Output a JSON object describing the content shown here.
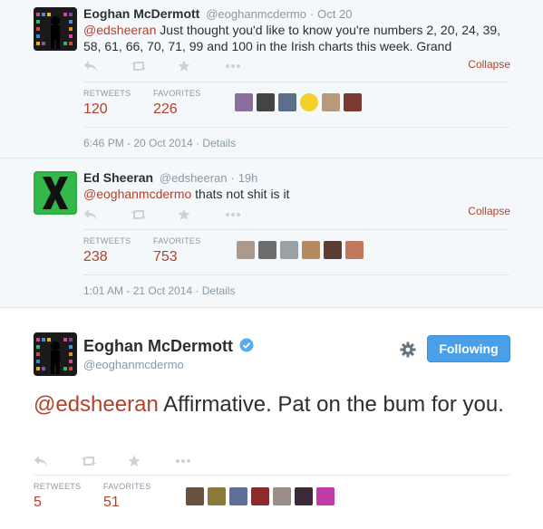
{
  "tweets": [
    {
      "name": "Eoghan McDermott",
      "handle": "@eoghanmcdermo",
      "date": "Oct 20",
      "mention": "@edsheeran",
      "text": " Just thought you'd like to know you're numbers 2, 20, 24, 39, 58, 61, 66, 70, 71, 99 and 100 in the Irish charts this week. Grand",
      "collapse": "Collapse",
      "retweets_label": "RETWEETS",
      "retweets": "120",
      "favorites_label": "FAVORITES",
      "favorites": "226",
      "timestamp": "6:46 PM - 20 Oct 2014",
      "details": "Details"
    },
    {
      "name": "Ed Sheeran",
      "handle": "@edsheeran",
      "date": "19h",
      "mention": "@eoghanmcdermo",
      "text": " thats not shit is it",
      "collapse": "Collapse",
      "retweets_label": "RETWEETS",
      "retweets": "238",
      "favorites_label": "FAVORITES",
      "favorites": "753",
      "timestamp": "1:01 AM - 21 Oct 2014",
      "details": "Details"
    }
  ],
  "main": {
    "name": "Eoghan McDermott",
    "handle": "@eoghanmcdermo",
    "follow_label": "Following",
    "mention": "@edsheeran",
    "text": " Affirmative. Pat on the bum for you.",
    "retweets_label": "RETWEETS",
    "retweets": "5",
    "favorites_label": "FAVORITES",
    "favorites": "51"
  },
  "icons": {
    "reply": "reply-icon",
    "retweet": "retweet-icon",
    "favorite": "star-icon",
    "more": "more-icon",
    "verified": "verified-icon",
    "settings": "gear-icon"
  },
  "colors": {
    "link": "#b3412b",
    "follow_button": "#4aa0e8",
    "verified": "#55acee"
  }
}
